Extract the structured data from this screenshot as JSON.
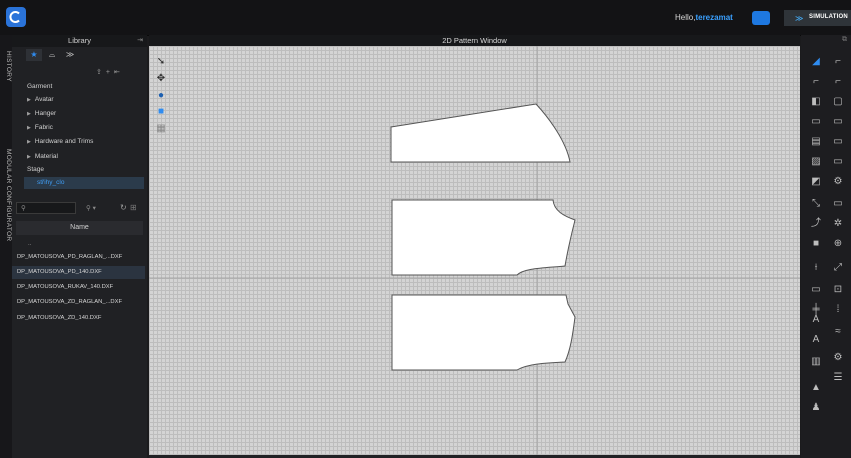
{
  "header": {
    "greeting": "Hello,",
    "username": "terezamat",
    "simulation_label": "SIMULATION"
  },
  "side_tabs": {
    "history": "HISTORY",
    "modular": "MODULAR CONFIGURATOR"
  },
  "library": {
    "title": "Library",
    "tree": [
      {
        "label": "Garment",
        "expandable": false
      },
      {
        "label": "Avatar",
        "expandable": true
      },
      {
        "label": "Hanger",
        "expandable": true
      },
      {
        "label": "Fabric",
        "expandable": true
      },
      {
        "label": "Hardware and Trims",
        "expandable": true
      },
      {
        "label": "Material",
        "expandable": true
      },
      {
        "label": "Stage",
        "expandable": false
      },
      {
        "label": "střihy_clo",
        "expandable": false
      }
    ],
    "search_placeholder": "",
    "name_header": "Name",
    "up_dir": "..",
    "files": [
      "DP_MATOUSOVA_PD_RAGLAN_...DXF",
      "DP_MATOUSOVA_PD_140.DXF",
      "DP_MATOUSOVA_RUKAV_140.DXF",
      "DP_MATOUSOVA_ZD_RAGLAN_...DXF",
      "DP_MATOUSOVA_ZD_140.DXF"
    ],
    "selected_file_index": 1
  },
  "pattern_window": {
    "title": "2D Pattern Window"
  },
  "icons": {
    "app": "clo-logo-icon",
    "cloud": "cloud-sync-icon",
    "simulation": "simulation-chevron-icon",
    "favorites": "star-icon",
    "tab2": "hanger-icon",
    "tab3": "fabric-icon",
    "upload": "upload-icon",
    "add": "plus-icon",
    "back": "back-icon"
  },
  "colors": {
    "accent": "#2f8cf0",
    "username": "#3aa0ff",
    "selection": "#2b3b4b"
  }
}
